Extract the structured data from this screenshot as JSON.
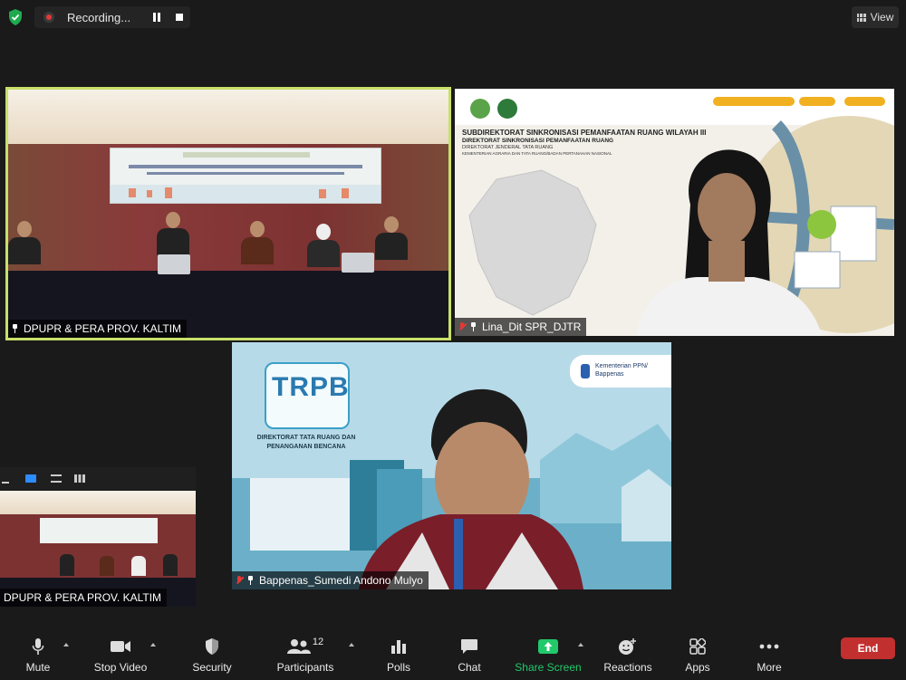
{
  "topbar": {
    "recording_label": "Recording...",
    "view_label": "View"
  },
  "tiles": [
    {
      "name": "DPUPR & PERA PROV. KALTIM",
      "active_speaker": true
    },
    {
      "name": "Lina_Dit SPR_DJTR",
      "muted": true
    },
    {
      "name": "Bappenas_Sumedi Andono Mulyo",
      "muted": true
    }
  ],
  "tile2_slide": {
    "title1": "SUBDIREKTORAT SINKRONISASI PEMANFAATAN RUANG WILAYAH III",
    "title2": "DIREKTORAT SINKRONISASI PEMANFAATAN RUANG",
    "title3": "DIREKTORAT JENDERAL TATA RUANG",
    "title4": "KEMENTERIAN AGRARIA DAN TATA RUANG/BADAN PERTANAHAN NASIONAL"
  },
  "tile3_slide": {
    "logo_text": "TRPB",
    "logo_caption_1": "DIREKTORAT TATA RUANG DAN",
    "logo_caption_2": "PENANGANAN BENCANA",
    "org_line1": "Kementerian PPN/",
    "org_line2": "Bappenas"
  },
  "selfview": {
    "name": "DPUPR & PERA PROV. KALTIM"
  },
  "toolbar": {
    "mute": "Mute",
    "stop_video": "Stop Video",
    "security": "Security",
    "participants": "Participants",
    "participants_count": "12",
    "polls": "Polls",
    "chat": "Chat",
    "share_screen": "Share Screen",
    "reactions": "Reactions",
    "apps": "Apps",
    "more": "More",
    "end": "End"
  },
  "colors": {
    "active_border": "#c8e06a",
    "share_green": "#21c96a",
    "end_red": "#c22f2f",
    "muted_red": "#e53935"
  }
}
